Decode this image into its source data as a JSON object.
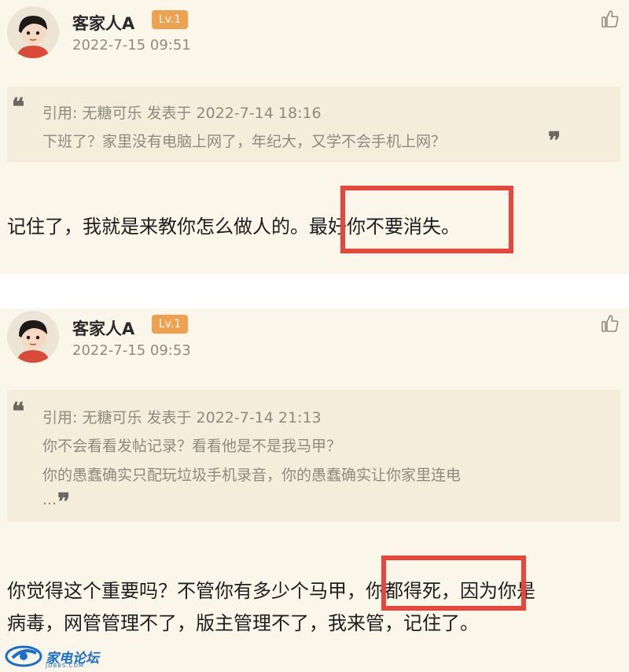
{
  "posts": [
    {
      "username": "客家人A",
      "level": "Lv.1",
      "time": "2022-7-15 09:51",
      "quote": {
        "header": "引用: 无糖可乐 发表于 2022-7-14 18:16",
        "lines": [
          "下班了？家里没有电脑上网了，年纪大，又学不会手机上网？"
        ]
      },
      "body_lines": [
        "记住了，我就是来教你怎么做人的。最好你不要消失。"
      ]
    },
    {
      "username": "客家人A",
      "level": "Lv.1",
      "time": "2022-7-15 09:53",
      "quote": {
        "header": "引用: 无糖可乐 发表于 2022-7-14 21:13",
        "lines": [
          "你不会看看发帖记录？看看他是不是我马甲？",
          "你的愚蠢确实只配玩垃圾手机录音，你的愚蠢确实让你家里连电",
          "..."
        ]
      },
      "body_lines": [
        "你觉得这个重要吗？不管你有多少个马甲，你都得死，因为你是",
        "病毒，网管管理不了，版主管理不了，我来管，记住了。"
      ]
    }
  ],
  "watermark": {
    "title": "家电论坛",
    "subtitle": "JDBBS.COM"
  },
  "colors": {
    "background": "#fbf6ea",
    "quote_bg": "#f4eddc",
    "badge": "#f0a150",
    "highlight": "#e8463a",
    "logo": "#1c6fc9"
  }
}
